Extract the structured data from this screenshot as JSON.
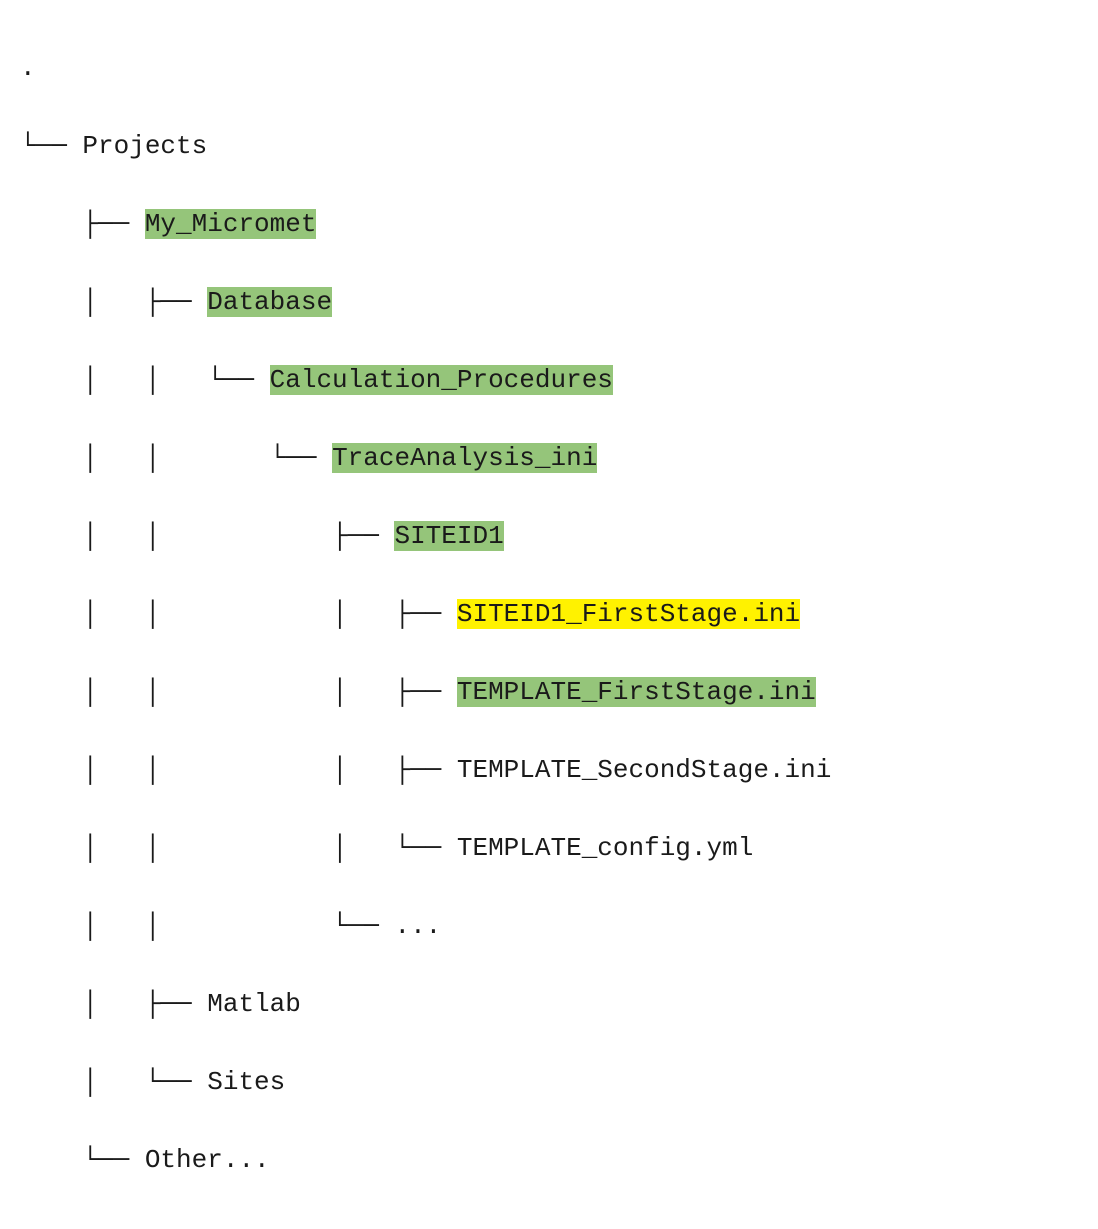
{
  "tree": {
    "root_dot": ".",
    "nodes": {
      "projects": "Projects",
      "my_micromet": "My_Micromet",
      "database": "Database",
      "calculation_procedures": "Calculation_Procedures",
      "traceanalysis_ini": "TraceAnalysis_ini",
      "siteid1": "SITEID1",
      "siteid1_firststage_ini": "SITEID1_FirstStage.ini",
      "template_firststage_ini": "TEMPLATE_FirstStage.ini",
      "template_secondstage_ini": "TEMPLATE_SecondStage.ini",
      "template_config_yml": "TEMPLATE_config.yml",
      "ellipsis": "...",
      "matlab": "Matlab",
      "sites": "Sites",
      "other": "Other..."
    }
  }
}
